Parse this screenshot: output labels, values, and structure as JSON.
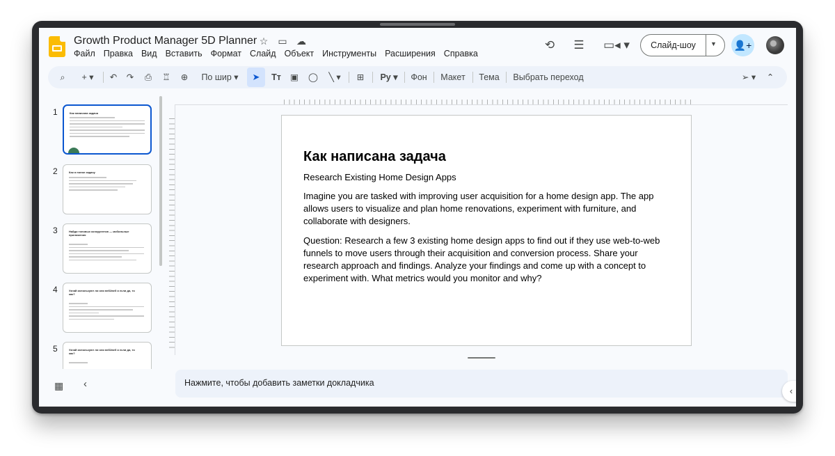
{
  "app": {
    "doc_title": "Growth Product Manager 5D Planner",
    "menu": [
      "Файл",
      "Правка",
      "Вид",
      "Вставить",
      "Формат",
      "Слайд",
      "Объект",
      "Инструменты",
      "Расширения",
      "Справка"
    ],
    "slideshow_label": "Слайд-шоу"
  },
  "toolbar": {
    "zoom_label": "По шир",
    "background_label": "Фон",
    "layout_label": "Макет",
    "theme_label": "Тема",
    "transition_label": "Выбрать переход"
  },
  "filmstrip": {
    "slides": [
      {
        "number": "1",
        "title": "Как написана задача"
      },
      {
        "number": "2",
        "title": "Как я понял задачу"
      },
      {
        "number": "3",
        "title": "Найди топовых конкурентов — мобильные приложения"
      },
      {
        "number": "4",
        "title": "Узнай используют ли они веб2веб и если да, то как?"
      },
      {
        "number": "5",
        "title": "Узнай используют ли они веб2веб и если да, то как?"
      }
    ]
  },
  "slide": {
    "title": "Как написана задача",
    "subtitle": "Research Existing Home Design Apps",
    "paragraph1": "Imagine you are tasked with improving user acquisition for a home design app. The app allows users to visualize and plan home renovations, experiment with furniture, and collaborate with designers.",
    "paragraph2": "Question: Research a few 3 existing home design apps to find out if they use web-to-web funnels to move users through their acquisition and conversion process. Share your research approach and findings. Analyze your findings and come up with a concept to experiment with. What metrics would you monitor and why?"
  },
  "notes": {
    "placeholder": "Нажмите, чтобы добавить заметки докладчика"
  },
  "colors": {
    "accent": "#0b57d0",
    "logo": "#fbbc04",
    "share": "#c2e7ff"
  }
}
